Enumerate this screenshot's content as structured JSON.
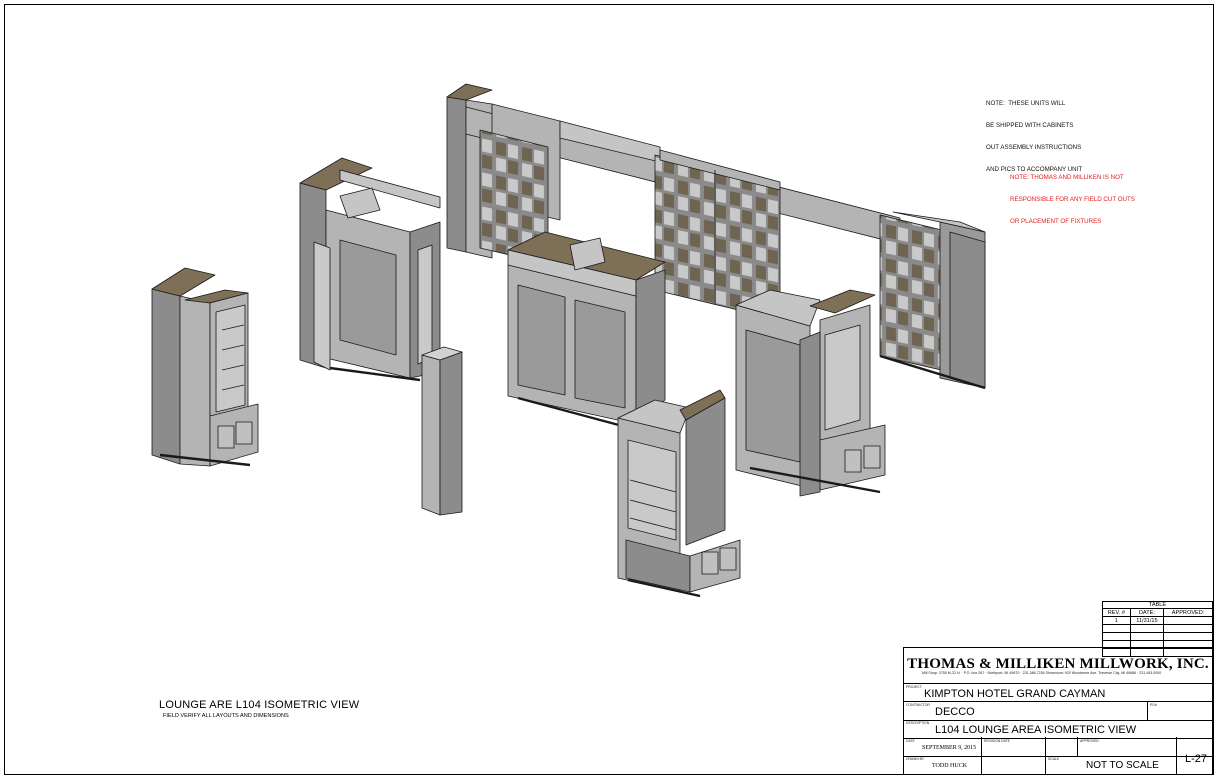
{
  "notes": {
    "shipping": [
      "NOTE:  THESE UNITS WILL",
      "BE SHIPPED WITH CABINETS",
      "OUT ASSEMBLY INSTRUCTIONS",
      "AND PICS TO ACCOMPANY UNIT"
    ],
    "responsibility": [
      "NOTE: THOMAS AND MILLIKEN IS NOT",
      "RESPONSIBLE FOR ANY FIELD CUT OUTS",
      "OR PLACEMENT OF FIXTURES"
    ]
  },
  "view": {
    "title": "LOUNGE ARE L104 ISOMETRIC VIEW",
    "subtitle": "FIELD VERIFY ALL LAYOUTS AND DIMENSIONS"
  },
  "revision_table": {
    "title": "TABLE",
    "headers": [
      "REV. #",
      "DATE:",
      "APPROVED:"
    ],
    "rows": [
      [
        "1",
        "11/31/15",
        ""
      ],
      [
        "",
        "",
        ""
      ],
      [
        "",
        "",
        ""
      ],
      [
        "",
        "",
        ""
      ],
      [
        "",
        "",
        ""
      ]
    ]
  },
  "title_block": {
    "company": "THOMAS & MILLIKEN MILLWORK, INC.",
    "address": "Mill Shop: 3755 M-22 N. · P.O. box 267 · Northport, MI 49670 · 231.386.7236        Showroom: 920 Woodmere Ave. Traverse City, MI 49686 · 231.493.0000",
    "labels": {
      "project": "PROJECT",
      "contractor": "CONTRACTOR",
      "po": "PO#",
      "description": "DESCRIPTION",
      "date": "DATE",
      "revision_date": "REVISION DATE",
      "approved": "APPROVED",
      "drawn_by": "DRAWN BY",
      "scale": "SCALE"
    },
    "project": "KIMPTON HOTEL GRAND CAYMAN",
    "contractor": "DECCO",
    "description": "L104 LOUNGE AREA  ISOMETRIC VIEW",
    "date": "SEPTEMBER 9, 2015",
    "drawn_by": "TODD HUCK",
    "scale": "NOT TO SCALE",
    "sheet": "L-27"
  },
  "colors": {
    "cabinet_face": "#b4b4b4",
    "cabinet_side": "#8c8c8c",
    "cabinet_top": "#d2d2d2",
    "wood_top": "#7e6f57",
    "shelf_wood": "#6f6452",
    "glass": "#9a9a9a",
    "red_note": "#e02020"
  }
}
